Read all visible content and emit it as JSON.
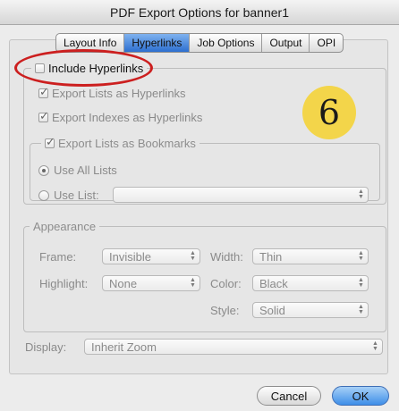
{
  "window": {
    "title": "PDF Export Options for banner1"
  },
  "tabs": [
    {
      "label": "Layout Info",
      "active": false
    },
    {
      "label": "Hyperlinks",
      "active": true
    },
    {
      "label": "Job Options",
      "active": false
    },
    {
      "label": "Output",
      "active": false
    },
    {
      "label": "OPI",
      "active": false
    }
  ],
  "hyperlinks": {
    "include_label": "Include Hyperlinks",
    "include_checked": false,
    "export_lists_label": "Export Lists as Hyperlinks",
    "export_lists_checked": true,
    "export_indexes_label": "Export Indexes as Hyperlinks",
    "export_indexes_checked": true,
    "bookmarks_label": "Export Lists as Bookmarks",
    "bookmarks_checked": true,
    "use_all_lists_label": "Use All Lists",
    "use_all_lists_selected": true,
    "use_list_label": "Use List:",
    "use_list_value": ""
  },
  "appearance": {
    "legend": "Appearance",
    "frame_label": "Frame:",
    "frame_value": "Invisible",
    "width_label": "Width:",
    "width_value": "Thin",
    "highlight_label": "Highlight:",
    "highlight_value": "None",
    "color_label": "Color:",
    "color_value": "Black",
    "style_label": "Style:",
    "style_value": "Solid"
  },
  "display": {
    "label": "Display:",
    "value": "Inherit Zoom"
  },
  "annotation": {
    "step_number": "6",
    "ellipse_color": "#cc1f1f",
    "badge_color": "#f3d54a"
  },
  "buttons": {
    "cancel": "Cancel",
    "ok": "OK"
  },
  "icons": {
    "checkmark": "checkmark-icon",
    "stepper": "up-down-stepper-icon",
    "radio": "radio-dot-icon"
  }
}
